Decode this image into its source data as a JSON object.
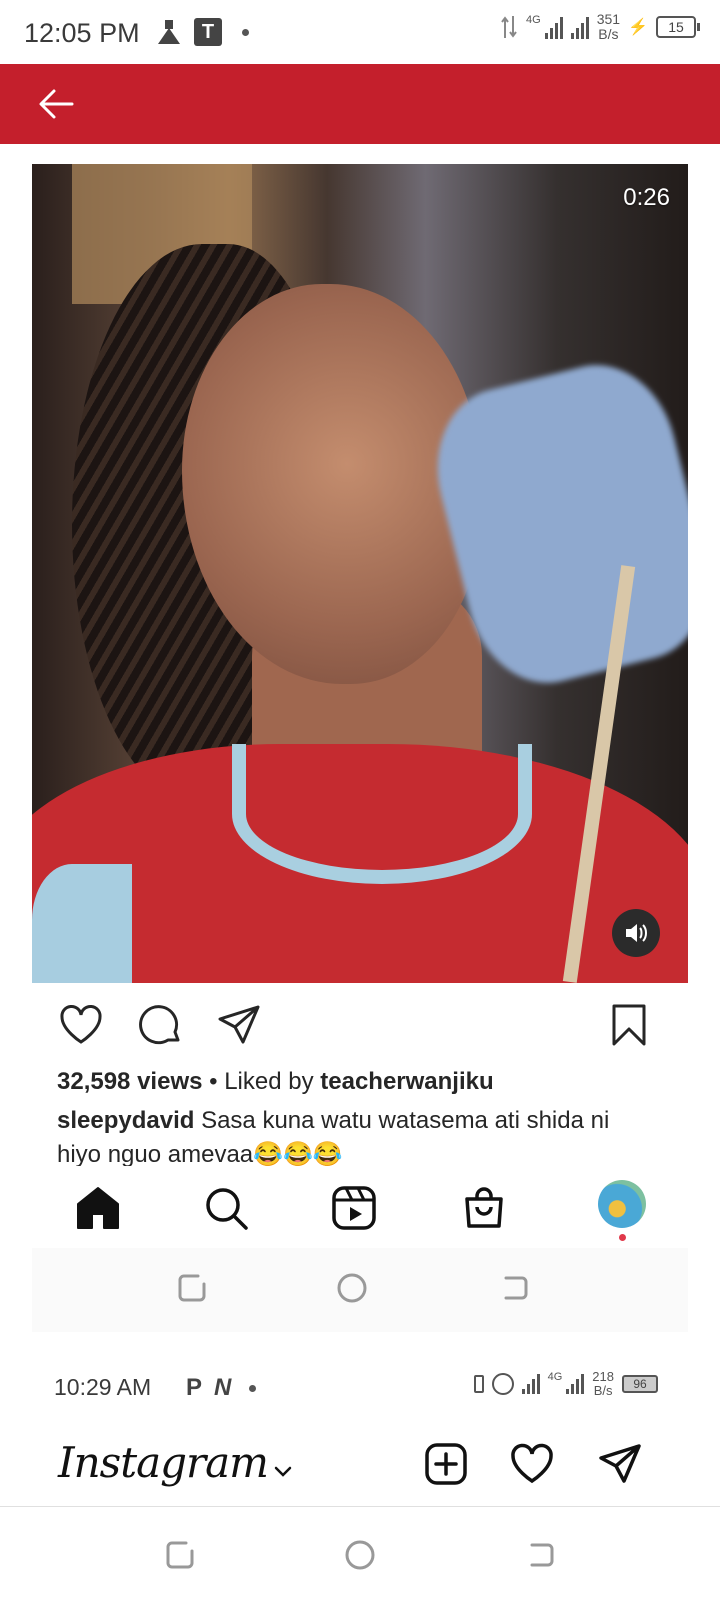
{
  "status_bar": {
    "time": "12:05 PM",
    "left_icons": [
      "flask-icon",
      "t-app-icon",
      "notification-dot"
    ],
    "network_type": "4G",
    "net_speed_value": "351",
    "net_speed_unit": "B/s",
    "battery_level": "15"
  },
  "header": {
    "background_color": "#c41f2c",
    "back_icon": "arrow-left-icon"
  },
  "video": {
    "duration": "0:26",
    "volume_icon": "volume-icon"
  },
  "post": {
    "actions": [
      "heart-icon",
      "comment-icon",
      "share-icon",
      "bookmark-icon"
    ],
    "views": "32,598 views",
    "liked_by_prefix": " • Liked by ",
    "liked_by_user": "teacherwanjiku",
    "caption_user": "sleepydavid",
    "caption_text": " Sasa kuna watu watasema ati shida ni hiyo nguo amevaa😂😂😂"
  },
  "bottom_nav": {
    "items": [
      "home-icon",
      "search-icon",
      "reels-icon",
      "shop-icon",
      "profile-avatar"
    ]
  },
  "inner_status_bar": {
    "time": "10:29 AM",
    "left_icons": [
      "P",
      "N"
    ],
    "network_type": "4G",
    "net_speed_value": "218",
    "net_speed_unit": "B/s",
    "battery_level": "96"
  },
  "instagram_header": {
    "logo": "Instagram",
    "buttons": [
      "add-post-icon",
      "heart-icon",
      "direct-message-icon"
    ]
  },
  "gesture_bar": {
    "buttons": [
      "recents-icon",
      "home-circle-icon",
      "back-icon"
    ]
  }
}
